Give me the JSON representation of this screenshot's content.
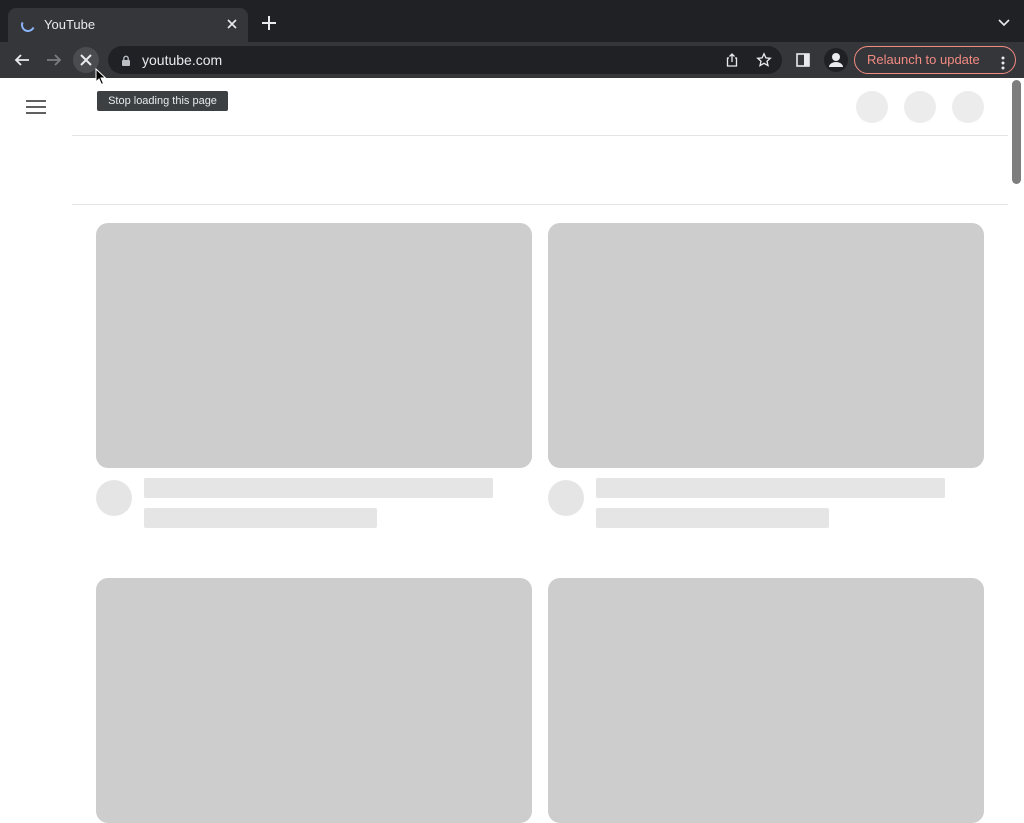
{
  "browser": {
    "tab_title": "YouTube",
    "url": "youtube.com",
    "relaunch_label": "Relaunch to update",
    "tooltip": "Stop loading this page",
    "colors": {
      "chrome_dark": "#202124",
      "toolbar": "#35363a",
      "relaunch_accent": "#f28b82",
      "spinner": "#8ab4f8"
    }
  },
  "page": {
    "state": "loading-skeleton",
    "header_buttons": [
      "skeleton-circle",
      "skeleton-circle",
      "skeleton-circle"
    ],
    "video_grid": {
      "rows": 2,
      "columns": 2,
      "cards": [
        "skeleton",
        "skeleton",
        "skeleton",
        "skeleton"
      ]
    },
    "colors": {
      "thumbnail_placeholder": "#cdcdcd",
      "text_placeholder": "#e5e5e5"
    }
  }
}
